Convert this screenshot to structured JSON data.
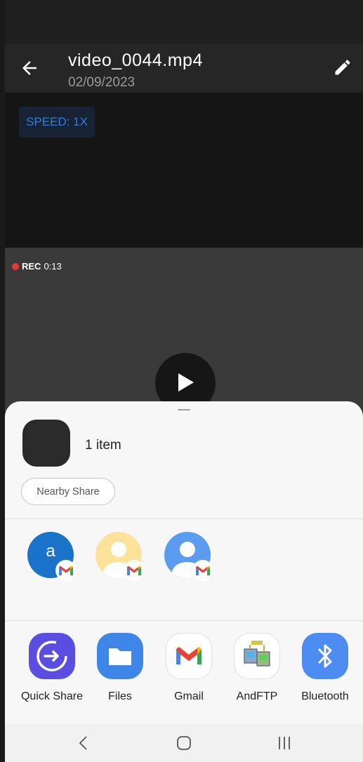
{
  "appbar": {
    "title": "video_0044.mp4",
    "date": "02/09/2023",
    "back_icon": "arrow-left-icon",
    "edit_icon": "pencil-icon"
  },
  "video": {
    "speed_label": "SPEED: 1X",
    "rec_label": "REC",
    "rec_time": "0:13"
  },
  "share_sheet": {
    "item_count": "1 item",
    "nearby_share_label": "Nearby Share",
    "contacts": [
      {
        "initial": "a",
        "color": "#1a73c9",
        "badge": "gmail-icon"
      },
      {
        "initial": "",
        "color": "#fde29a",
        "badge": "gmail-icon"
      },
      {
        "initial": "",
        "color": "#5b9cf0",
        "badge": "gmail-icon"
      }
    ],
    "apps": [
      {
        "label": "Quick Share",
        "icon": "quick-share-icon"
      },
      {
        "label": "Files",
        "icon": "folder-icon"
      },
      {
        "label": "Gmail",
        "icon": "gmail-icon"
      },
      {
        "label": "AndFTP",
        "icon": "andftp-icon"
      },
      {
        "label": "Bluetooth",
        "icon": "bluetooth-icon"
      }
    ]
  },
  "colors": {
    "speed_text": "#2f7ed8",
    "rec_dot": "#e53935",
    "sheet_bg": "#f7f7f7"
  }
}
